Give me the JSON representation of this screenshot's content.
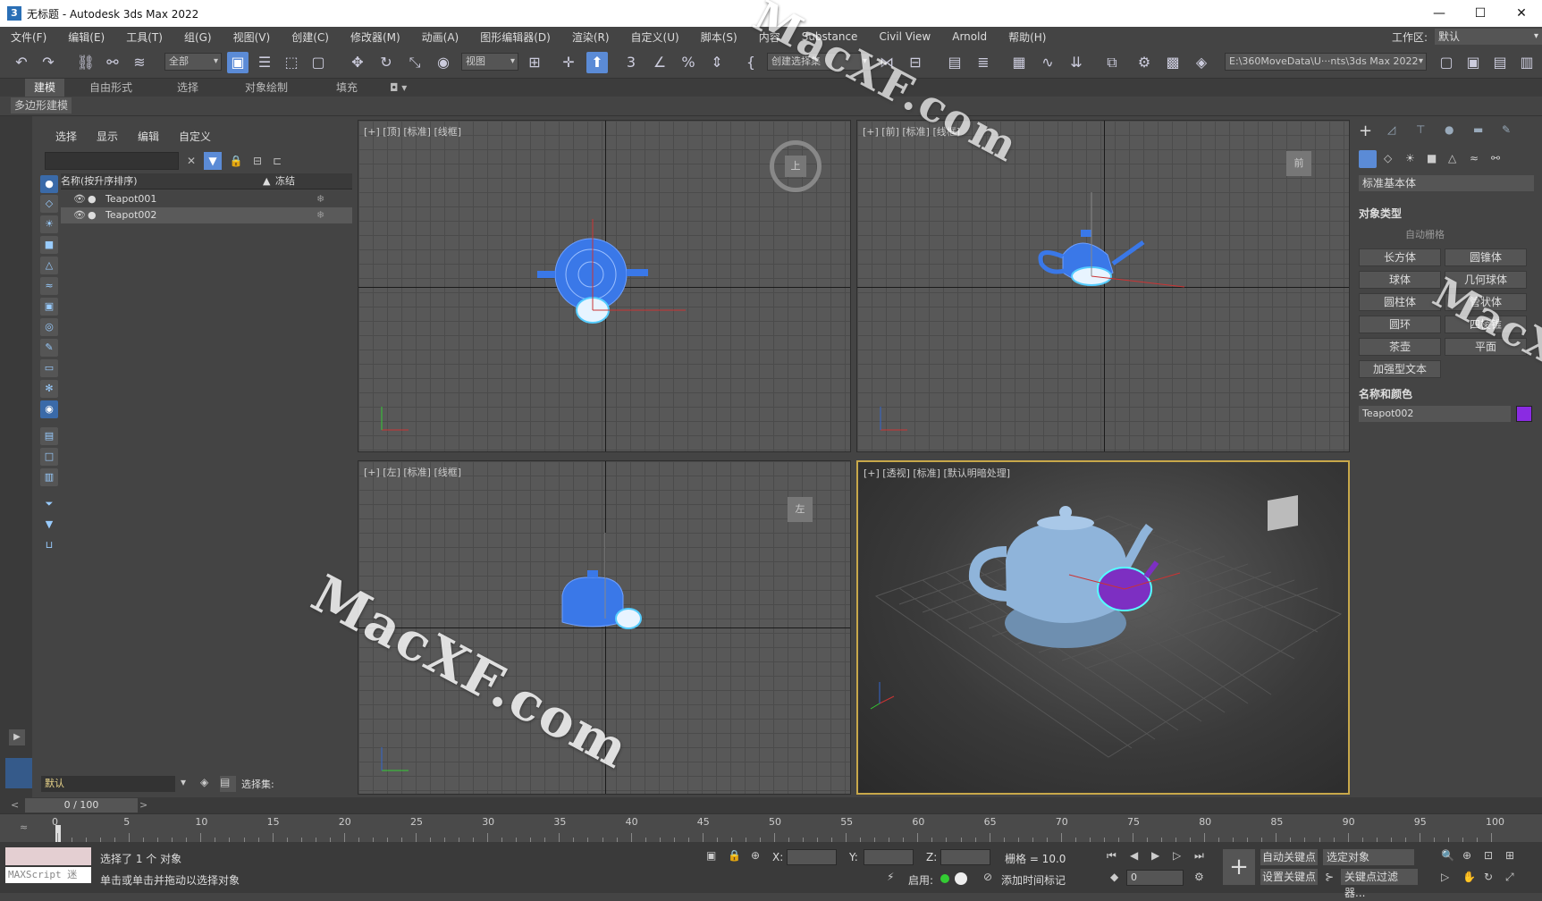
{
  "window": {
    "title": "无标题 - Autodesk 3ds Max 2022",
    "icon": "3",
    "minimize": "—",
    "maximize": "☐",
    "close": "✕"
  },
  "menu": {
    "items": [
      "文件(F)",
      "编辑(E)",
      "工具(T)",
      "组(G)",
      "视图(V)",
      "创建(C)",
      "修改器(M)",
      "动画(A)",
      "图形编辑器(D)",
      "渲染(R)",
      "自定义(U)",
      "脚本(S)",
      "内容",
      "Substance",
      "Civil View",
      "Arnold",
      "帮助(H)"
    ],
    "workspace_label": "工作区:",
    "workspace_value": "默认"
  },
  "toolbar": {
    "filter_all": "全部",
    "view_dropdown": "视图",
    "selection_set": "创建选择集",
    "path": "E:\\360MoveData\\U···nts\\3ds Max 2022"
  },
  "ribbon": {
    "tabs": [
      "建模",
      "自由形式",
      "选择",
      "对象绘制",
      "填充"
    ],
    "sub": "多边形建模"
  },
  "scene_explorer": {
    "tabs": [
      "选择",
      "显示",
      "编辑",
      "自定义"
    ],
    "col_name": "名称(按升序排序)",
    "col_frozen": "冻结",
    "rows": [
      {
        "name": "Teapot001",
        "selected": false
      },
      {
        "name": "Teapot002",
        "selected": true
      }
    ],
    "layer_value": "默认",
    "selection_set_label": "选择集:"
  },
  "viewports": {
    "top": {
      "label": "[+] [顶] [标准] [线框]"
    },
    "front": {
      "label": "[+] [前] [标准] [线框]"
    },
    "left": {
      "label": "[+] [左] [标准] [线框]"
    },
    "persp": {
      "label": "[+] [透视] [标准] [默认明暗处理]"
    }
  },
  "viewcube": {
    "top": "上",
    "front": "前",
    "left": "左"
  },
  "command_panel": {
    "category": "标准基本体",
    "object_type_title": "对象类型",
    "autogrid": "自动栅格",
    "buttons": [
      "长方体",
      "圆锥体",
      "球体",
      "几何球体",
      "圆柱体",
      "管状体",
      "圆环",
      "四棱锥",
      "茶壶",
      "平面",
      "加强型文本"
    ],
    "name_color_title": "名称和颜色",
    "object_name": "Teapot002",
    "object_color": "#8a2be2"
  },
  "timeline": {
    "frame": "0 / 100",
    "ticks": [
      "0",
      "5",
      "10",
      "15",
      "20",
      "25",
      "30",
      "35",
      "40",
      "45",
      "50",
      "55",
      "60",
      "65",
      "70",
      "75",
      "80",
      "85",
      "90",
      "95",
      "100"
    ]
  },
  "status": {
    "selected": "选择了 1 个 对象",
    "hint": "单击或单击并拖动以选择对象",
    "maxscript": "MAXScript 迷",
    "x_label": "X:",
    "y_label": "Y:",
    "z_label": "Z:",
    "grid": "栅格 = 10.0",
    "enable": "启用:",
    "add_time_tag": "添加时间标记",
    "auto_key": "自动关键点",
    "set_key": "设置关键点",
    "selected_object": "选定对象",
    "key_filter": "关键点过滤器...",
    "frame_value": "0"
  },
  "watermarks": [
    "MacXF.com",
    "MacXF.com",
    "MacX"
  ],
  "colors": {
    "accent": "#5b8bd6",
    "selection_wire": "#4f8fff",
    "active_viewport_border": "#c8a84a"
  }
}
